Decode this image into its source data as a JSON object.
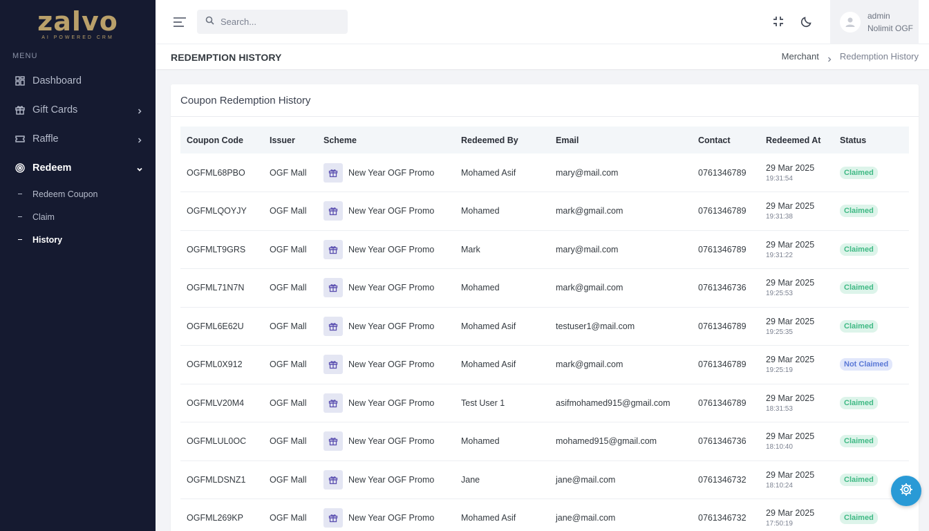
{
  "brand": {
    "name": "zalvo",
    "tagline": "AI POWERED CRM"
  },
  "sidebar": {
    "menu_title": "MENU",
    "items": [
      {
        "label": "Dashboard",
        "icon": "dashboard-icon"
      },
      {
        "label": "Gift Cards",
        "icon": "gift-icon"
      },
      {
        "label": "Raffle",
        "icon": "ticket-icon"
      },
      {
        "label": "Redeem",
        "icon": "target-icon"
      }
    ],
    "sub_items": [
      {
        "label": "Redeem Coupon"
      },
      {
        "label": "Claim"
      },
      {
        "label": "History"
      }
    ]
  },
  "topbar": {
    "search_placeholder": "Search...",
    "user": {
      "name": "admin",
      "org": "Nolimit OGF"
    }
  },
  "page": {
    "title": "REDEMPTION HISTORY",
    "breadcrumb": {
      "parent": "Merchant",
      "current": "Redemption History"
    }
  },
  "card": {
    "title": "Coupon Redemption History"
  },
  "table": {
    "headers": [
      "Coupon Code",
      "Issuer",
      "Scheme",
      "Redeemed By",
      "Email",
      "Contact",
      "Redeemed At",
      "Status"
    ],
    "rows": [
      {
        "code": "OGFML68PBO",
        "issuer": "OGF Mall",
        "scheme": "New Year OGF Promo",
        "by": "Mohamed Asif",
        "email": "mary@mail.com",
        "contact": "0761346789",
        "date": "29 Mar 2025",
        "time": "19:31:54",
        "status": "Claimed"
      },
      {
        "code": "OGFMLQOYJY",
        "issuer": "OGF Mall",
        "scheme": "New Year OGF Promo",
        "by": "Mohamed",
        "email": "mark@gmail.com",
        "contact": "0761346789",
        "date": "29 Mar 2025",
        "time": "19:31:38",
        "status": "Claimed"
      },
      {
        "code": "OGFMLT9GRS",
        "issuer": "OGF Mall",
        "scheme": "New Year OGF Promo",
        "by": "Mark",
        "email": "mary@mail.com",
        "contact": "0761346789",
        "date": "29 Mar 2025",
        "time": "19:31:22",
        "status": "Claimed"
      },
      {
        "code": "OGFML71N7N",
        "issuer": "OGF Mall",
        "scheme": "New Year OGF Promo",
        "by": "Mohamed",
        "email": "mark@gmail.com",
        "contact": "0761346736",
        "date": "29 Mar 2025",
        "time": "19:25:53",
        "status": "Claimed"
      },
      {
        "code": "OGFML6E62U",
        "issuer": "OGF Mall",
        "scheme": "New Year OGF Promo",
        "by": "Mohamed Asif",
        "email": "testuser1@mail.com",
        "contact": "0761346789",
        "date": "29 Mar 2025",
        "time": "19:25:35",
        "status": "Claimed"
      },
      {
        "code": "OGFML0X912",
        "issuer": "OGF Mall",
        "scheme": "New Year OGF Promo",
        "by": "Mohamed Asif",
        "email": "mark@gmail.com",
        "contact": "0761346789",
        "date": "29 Mar 2025",
        "time": "19:25:19",
        "status": "Not Claimed"
      },
      {
        "code": "OGFMLV20M4",
        "issuer": "OGF Mall",
        "scheme": "New Year OGF Promo",
        "by": "Test User 1",
        "email": "asifmohamed915@gmail.com",
        "contact": "0761346789",
        "date": "29 Mar 2025",
        "time": "18:31:53",
        "status": "Claimed"
      },
      {
        "code": "OGFMLUL0OC",
        "issuer": "OGF Mall",
        "scheme": "New Year OGF Promo",
        "by": "Mohamed",
        "email": "mohamed915@gmail.com",
        "contact": "0761346736",
        "date": "29 Mar 2025",
        "time": "18:10:40",
        "status": "Claimed"
      },
      {
        "code": "OGFMLDSNZ1",
        "issuer": "OGF Mall",
        "scheme": "New Year OGF Promo",
        "by": "Jane",
        "email": "jane@mail.com",
        "contact": "0761346732",
        "date": "29 Mar 2025",
        "time": "18:10:24",
        "status": "Claimed"
      },
      {
        "code": "OGFML269KP",
        "issuer": "OGF Mall",
        "scheme": "New Year OGF Promo",
        "by": "Mohamed Asif",
        "email": "jane@mail.com",
        "contact": "0761346732",
        "date": "29 Mar 2025",
        "time": "17:50:19",
        "status": "Claimed"
      }
    ]
  },
  "colors": {
    "sidebar_bg": "#151a30",
    "brand_gold": "#b9a06a",
    "claimed_bg": "#ddf4ea",
    "claimed_text": "#3fb984",
    "not_claimed_bg": "#e1e7fb",
    "not_claimed_text": "#5a78d6",
    "fab": "#299ad6"
  }
}
